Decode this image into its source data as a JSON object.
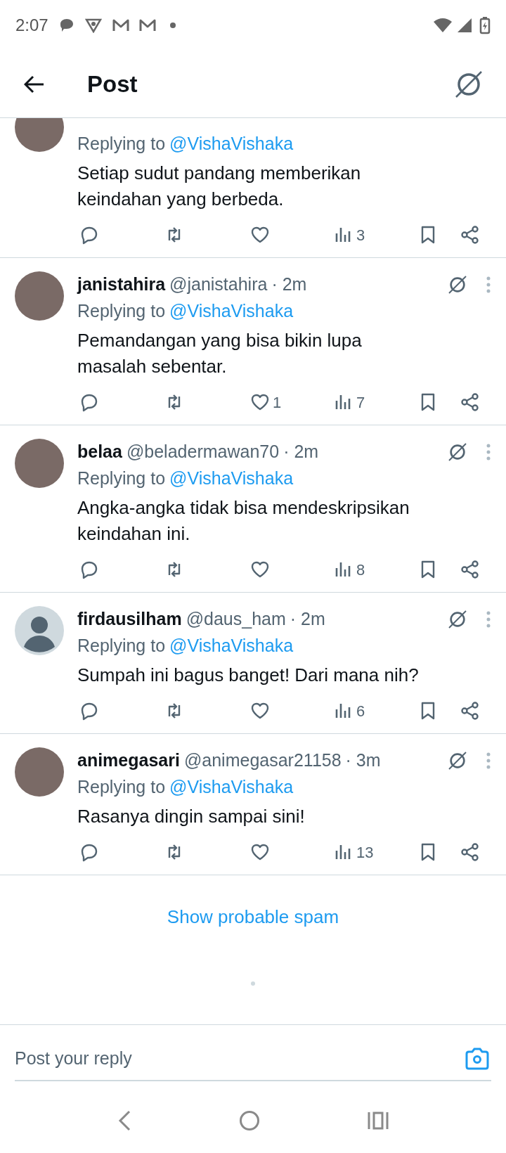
{
  "status_bar": {
    "time": "2:07"
  },
  "header": {
    "title": "Post"
  },
  "replies": [
    {
      "avatar": {
        "kind": "photo"
      },
      "replying_label": "Replying to",
      "replying_to": "@VishaVishaka",
      "text": "Setiap sudut pandang memberikan keindahan yang berbeda.",
      "views": "3"
    },
    {
      "avatar": {
        "kind": "photo"
      },
      "name": "janistahira",
      "handle": "@janistahira",
      "time": "· 2m",
      "replying_label": "Replying to",
      "replying_to": "@VishaVishaka",
      "text": "Pemandangan yang bisa bikin lupa masalah sebentar.",
      "likes": "1",
      "views": "7"
    },
    {
      "avatar": {
        "kind": "photo"
      },
      "name": "belaa",
      "handle": "@beladermawan70",
      "time": "· 2m",
      "replying_label": "Replying to",
      "replying_to": "@VishaVishaka",
      "text": "Angka-angka tidak bisa mendeskripsikan keindahan ini.",
      "views": "8"
    },
    {
      "avatar": {
        "kind": "default"
      },
      "name": "firdausilham",
      "handle": "@daus_ham",
      "time": "· 2m",
      "replying_label": "Replying to",
      "replying_to": "@VishaVishaka",
      "text": "Sumpah ini bagus banget! Dari mana nih?",
      "views": "6"
    },
    {
      "avatar": {
        "kind": "photo"
      },
      "name": "animegasari",
      "handle": "@animegasar21158",
      "time": "· 3m",
      "replying_label": "Replying to",
      "replying_to": "@VishaVishaka",
      "text": "Rasanya dingin sampai sini!",
      "views": "13"
    }
  ],
  "spam_link": "Show probable spam",
  "reply_field": {
    "placeholder": "Post your reply"
  }
}
